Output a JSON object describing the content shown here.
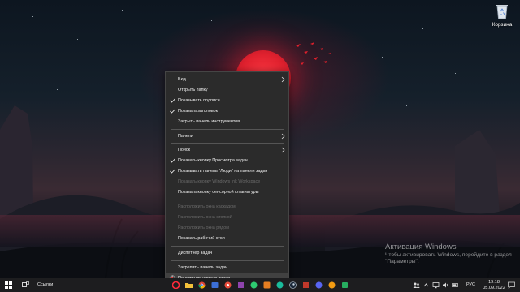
{
  "desktop": {
    "recycle_bin_label": "Корзина"
  },
  "watermark": {
    "title": "Активация Windows",
    "line1": "Чтобы активировать Windows, перейдите в раздел",
    "line2": "\"Параметры\"."
  },
  "context_menu": {
    "items": [
      {
        "label": "Вид",
        "checked": false,
        "disabled": false,
        "submenu": true
      },
      {
        "label": "Открыть папку",
        "checked": false,
        "disabled": false,
        "submenu": false
      },
      {
        "label": "Показывать подписи",
        "checked": true,
        "disabled": false,
        "submenu": false
      },
      {
        "label": "Показать заголовок",
        "checked": true,
        "disabled": false,
        "submenu": false
      },
      {
        "label": "Закрыть панель инструментов",
        "checked": false,
        "disabled": false,
        "submenu": false
      },
      {
        "label": "Панели",
        "checked": false,
        "disabled": false,
        "submenu": true
      },
      {
        "label": "Поиск",
        "checked": false,
        "disabled": false,
        "submenu": true
      },
      {
        "label": "Показать кнопку Просмотра задач",
        "checked": true,
        "disabled": false,
        "submenu": false
      },
      {
        "label": "Показывать панель \"Люди\" на панели задач",
        "checked": true,
        "disabled": false,
        "submenu": false
      },
      {
        "label": "Показать кнопку Windows Ink Workspace",
        "checked": false,
        "disabled": true,
        "submenu": false
      },
      {
        "label": "Показать кнопку сенсорной клавиатуры",
        "checked": false,
        "disabled": false,
        "submenu": false
      },
      {
        "label": "Расположить окна каскадом",
        "checked": false,
        "disabled": true,
        "submenu": false
      },
      {
        "label": "Расположить окна стопкой",
        "checked": false,
        "disabled": true,
        "submenu": false
      },
      {
        "label": "Расположить окна рядом",
        "checked": false,
        "disabled": true,
        "submenu": false
      },
      {
        "label": "Показать рабочий стол",
        "checked": false,
        "disabled": false,
        "submenu": false
      },
      {
        "label": "Диспетчер задач",
        "checked": false,
        "disabled": false,
        "submenu": false
      },
      {
        "label": "Закрепить панель задач",
        "checked": false,
        "disabled": false,
        "submenu": false
      },
      {
        "label": "Параметры панели задач",
        "checked": false,
        "disabled": false,
        "submenu": false,
        "icon": "gear-icon"
      }
    ]
  },
  "taskbar": {
    "links_label": "Ссылки",
    "language": "РУС",
    "time": "19:18",
    "date": "05.09.2022"
  },
  "colors": {
    "menu_bg": "#2b2b2b",
    "taskbar_bg": "#1d1d1f",
    "sun": "#e0212e"
  },
  "icons": [
    "windows-start-icon",
    "task-view-icon",
    "recycle-bin-icon",
    "gear-icon",
    "chevron-right-icon",
    "checkmark-icon"
  ]
}
